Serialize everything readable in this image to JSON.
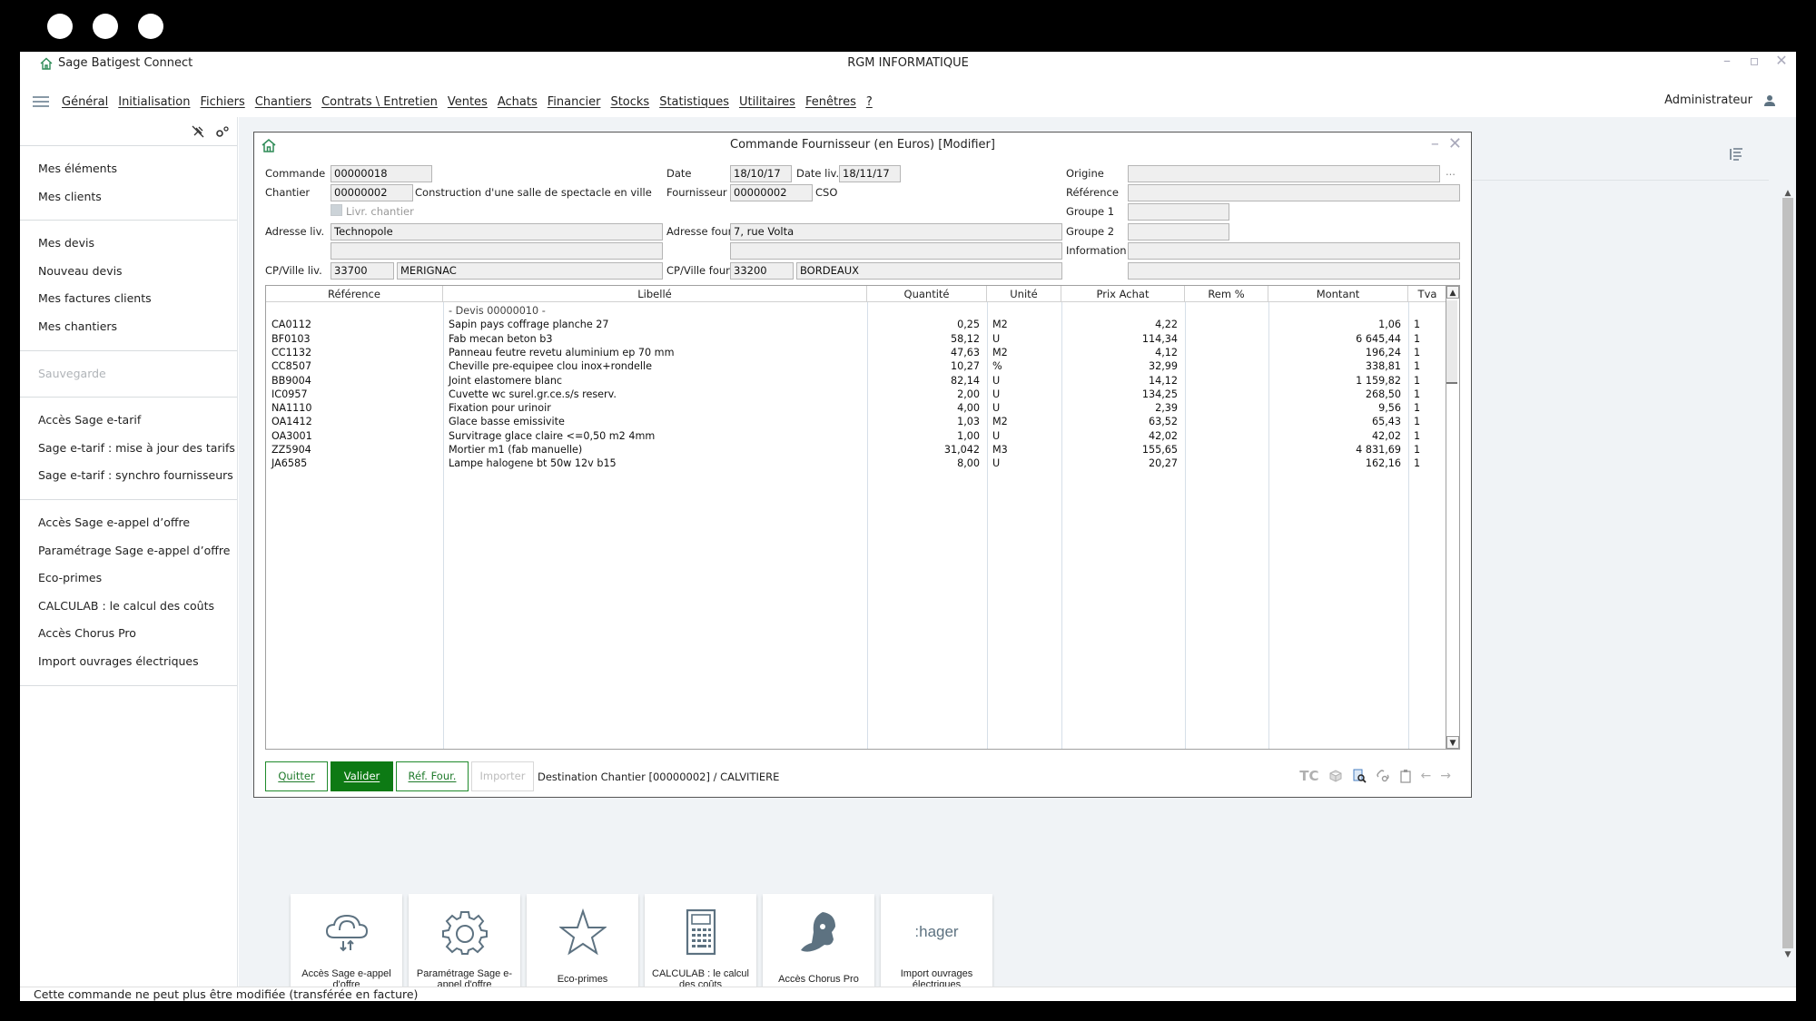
{
  "window": {
    "app_title": "Sage Batigest Connect",
    "company": "RGM INFORMATIQUE",
    "controls": [
      "minimize",
      "maximize",
      "close"
    ]
  },
  "menubar": {
    "items": [
      "Général",
      "Initialisation",
      "Fichiers",
      "Chantiers",
      "Contrats \\ Entretien",
      "Ventes",
      "Achats",
      "Financier",
      "Stocks",
      "Statistiques",
      "Utilitaires",
      "Fenêtres",
      "?"
    ],
    "user": "Administrateur"
  },
  "sidebar": {
    "groups": [
      {
        "items": [
          {
            "label": "Mes éléments"
          },
          {
            "label": "Mes clients"
          }
        ]
      },
      {
        "items": [
          {
            "label": "Mes devis"
          },
          {
            "label": "Nouveau devis"
          },
          {
            "label": "Mes factures clients"
          },
          {
            "label": "Mes chantiers"
          }
        ]
      },
      {
        "items": [
          {
            "label": "Sauvegarde",
            "disabled": true
          }
        ]
      },
      {
        "items": [
          {
            "label": "Accès Sage e-tarif"
          },
          {
            "label": "Sage e-tarif : mise à jour des tarifs"
          },
          {
            "label": "Sage e-tarif : synchro fournisseurs"
          }
        ]
      },
      {
        "items": [
          {
            "label": "Accès Sage e-appel d’offre"
          },
          {
            "label": "Paramétrage Sage e-appel d’offre"
          },
          {
            "label": "Eco-primes"
          },
          {
            "label": "CALCULAB : le calcul des coûts"
          },
          {
            "label": "Accès Chorus Pro"
          },
          {
            "label": "Import ouvrages électriques"
          }
        ]
      }
    ]
  },
  "order": {
    "title": "Commande Fournisseur (en Euros) [Modifier]",
    "labels": {
      "commande": "Commande",
      "chantier": "Chantier",
      "livr_chantier": "Livr. chantier",
      "adresse_liv": "Adresse liv.",
      "cp_ville_liv": "CP/Ville liv.",
      "date": "Date",
      "date_liv": "Date liv.",
      "fournisseur": "Fournisseur",
      "adresse_four": "Adresse four.",
      "cp_ville_four": "CP/Ville four.",
      "origine": "Origine",
      "reference": "Référence",
      "groupe1": "Groupe 1",
      "groupe2": "Groupe 2",
      "information": "Information"
    },
    "values": {
      "commande": "00000018",
      "chantier": "00000002",
      "chantier_desc": "Construction d'une salle de spectacle en ville",
      "livr_chantier_checked": false,
      "adresse_liv_1": "Technopole",
      "adresse_liv_2": "",
      "cp_liv": "33700",
      "ville_liv": "MERIGNAC",
      "date": "18/10/17",
      "date_liv": "18/11/17",
      "fournisseur": "00000002",
      "fournisseur_name": "CSO",
      "adresse_four_1": "7, rue Volta",
      "adresse_four_2": "",
      "cp_four": "33200",
      "ville_four": "BORDEAUX",
      "origine": "",
      "origine_more": "...",
      "reference": "",
      "groupe1": "",
      "groupe2": "",
      "information_1": "",
      "information_2": ""
    },
    "grid": {
      "headers": [
        "Référence",
        "Libellé",
        "Quantité",
        "Unité",
        "Prix Achat",
        "Rem %",
        "Montant",
        "Tva"
      ],
      "group_label": "- Devis 00000010 -",
      "rows": [
        {
          "ref": "CA0112",
          "libelle": "Sapin pays coffrage planche 27",
          "qte": "0,25",
          "unite": "M2",
          "prix": "4,22",
          "rem": "",
          "montant": "1,06",
          "tva": "1"
        },
        {
          "ref": "BF0103",
          "libelle": "Fab mecan beton b3",
          "qte": "58,12",
          "unite": "U",
          "prix": "114,34",
          "rem": "",
          "montant": "6 645,44",
          "tva": "1"
        },
        {
          "ref": "CC1132",
          "libelle": "Panneau feutre revetu aluminium ep 70 mm",
          "qte": "47,63",
          "unite": "M2",
          "prix": "4,12",
          "rem": "",
          "montant": "196,24",
          "tva": "1"
        },
        {
          "ref": "CC8507",
          "libelle": "Cheville pre-equipee clou inox+rondelle",
          "qte": "10,27",
          "unite": "%",
          "prix": "32,99",
          "rem": "",
          "montant": "338,81",
          "tva": "1"
        },
        {
          "ref": "BB9004",
          "libelle": "Joint elastomere blanc",
          "qte": "82,14",
          "unite": "U",
          "prix": "14,12",
          "rem": "",
          "montant": "1 159,82",
          "tva": "1"
        },
        {
          "ref": "IC0957",
          "libelle": "Cuvette wc surel.gr.ce.s/s reserv.",
          "qte": "2,00",
          "unite": "U",
          "prix": "134,25",
          "rem": "",
          "montant": "268,50",
          "tva": "1"
        },
        {
          "ref": "NA1110",
          "libelle": "Fixation pour urinoir",
          "qte": "4,00",
          "unite": "U",
          "prix": "2,39",
          "rem": "",
          "montant": "9,56",
          "tva": "1"
        },
        {
          "ref": "OA1412",
          "libelle": "Glace basse emissivite",
          "qte": "1,03",
          "unite": "M2",
          "prix": "63,52",
          "rem": "",
          "montant": "65,43",
          "tva": "1"
        },
        {
          "ref": "OA3001",
          "libelle": "Survitrage glace claire <=0,50 m2 4mm",
          "qte": "1,00",
          "unite": "U",
          "prix": "42,02",
          "rem": "",
          "montant": "42,02",
          "tva": "1"
        },
        {
          "ref": "ZZ5904",
          "libelle": "Mortier m1 (fab manuelle)",
          "qte": "31,042",
          "unite": "M3",
          "prix": "155,65",
          "rem": "",
          "montant": "4 831,69",
          "tva": "1"
        },
        {
          "ref": "JA6585",
          "libelle": "Lampe halogene bt 50w 12v b15",
          "qte": "8,00",
          "unite": "U",
          "prix": "20,27",
          "rem": "",
          "montant": "162,16",
          "tva": "1"
        }
      ]
    },
    "buttons": {
      "quitter": "Quitter",
      "valider": "Valider",
      "ref_four": "Réf. Four.",
      "importer": "Importer"
    },
    "destination": "Destination Chantier [00000002] / CALVITIERE",
    "toolbar_icons": [
      "tc-icon",
      "box-icon",
      "document-search-icon",
      "link-settings-icon",
      "clipboard-icon",
      "arrow-left-icon",
      "arrow-right-icon"
    ],
    "toolbar_text": {
      "tc": "TC"
    }
  },
  "tiles": [
    {
      "label": "Accès Sage e-appel d'offre",
      "icon": "cloud-sync-icon"
    },
    {
      "label": "Paramétrage Sage e-appel d'offre",
      "icon": "gear-icon"
    },
    {
      "label": "Eco-primes",
      "icon": "star-icon"
    },
    {
      "label": "CALCULAB : le calcul des coûts",
      "icon": "calculator-icon"
    },
    {
      "label": "Accès Chorus Pro",
      "icon": "chorus-pro-icon"
    },
    {
      "label": "Import ouvrages électriques",
      "icon": "hager-logo",
      "logo_text": ":hager"
    }
  ],
  "statusbar": {
    "message": "Cette commande ne peut plus être modifiée (transférée en facture)"
  },
  "colors": {
    "accent_green": "#0d7a14",
    "home_icon_green": "#2e8b57",
    "icon_slate": "#5d7281"
  }
}
